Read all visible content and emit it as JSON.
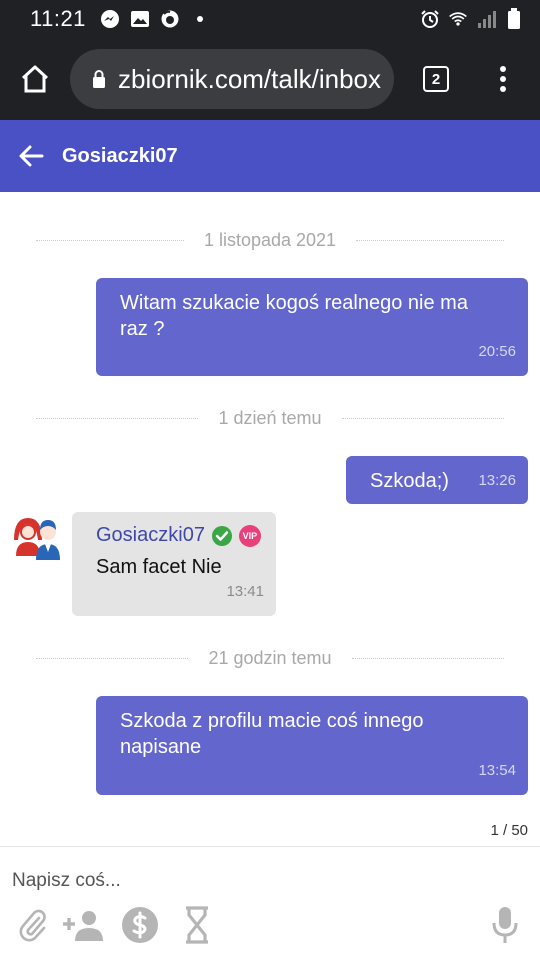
{
  "status_bar": {
    "time": "11:21",
    "left_icons": [
      "messenger-icon",
      "gallery-icon",
      "firefox-icon",
      "dot-icon"
    ],
    "right_icons": [
      "alarm-icon",
      "wifi-icon",
      "signal-icon",
      "battery-icon"
    ]
  },
  "browser": {
    "url": "zbiornik.com/talk/inbox",
    "tab_count": "2"
  },
  "header": {
    "title": "Gosiaczki07"
  },
  "chat": {
    "separators": [
      "1 listopada 2021",
      "1 dzień temu",
      "21 godzin temu"
    ],
    "messages": [
      {
        "direction": "out",
        "text_line1": "Witam szukacie kogoś realnego nie ma",
        "text_line2": "raz ?",
        "time": "20:56"
      },
      {
        "direction": "out",
        "text": "Szkoda;)",
        "time": "13:26"
      },
      {
        "direction": "in",
        "sender": "Gosiaczki07",
        "badge": "VIP",
        "text": "Sam facet Nie",
        "time": "13:41"
      },
      {
        "direction": "out",
        "text_line1": "Szkoda z profilu macie coś innego",
        "text_line2": "napisane",
        "time": "13:54"
      }
    ],
    "page_counter": "1 / 50"
  },
  "composer": {
    "placeholder": "Napisz coś..."
  },
  "colors": {
    "header": "#4a51c5",
    "bubble_out": "#6366cc",
    "bubble_in": "#e4e4e4",
    "verified": "#3aa645",
    "vip": "#e8407a"
  }
}
